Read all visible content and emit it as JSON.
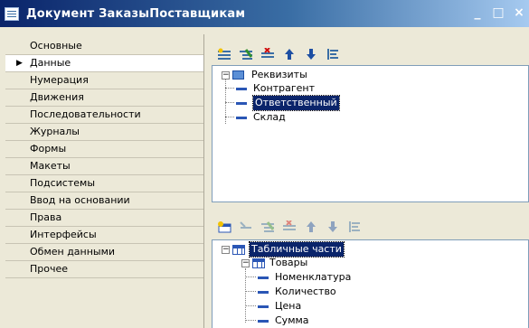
{
  "window": {
    "title": "Документ ЗаказыПоставщикам",
    "controls": [
      "_",
      "□",
      "×"
    ]
  },
  "nav": {
    "items": [
      {
        "label": "Основные"
      },
      {
        "label": "Данные",
        "selected": true
      },
      {
        "label": "Нумерация"
      },
      {
        "label": "Движения"
      },
      {
        "label": "Последовательности"
      },
      {
        "label": "Журналы"
      },
      {
        "label": "Формы"
      },
      {
        "label": "Макеты"
      },
      {
        "label": "Подсистемы"
      },
      {
        "label": "Ввод на основании"
      },
      {
        "label": "Права"
      },
      {
        "label": "Интерфейсы"
      },
      {
        "label": "Обмен данными"
      },
      {
        "label": "Прочее"
      }
    ]
  },
  "attributes_tree": {
    "root": "Реквизиты",
    "children": [
      "Контрагент",
      "Ответственный",
      "Склад"
    ],
    "selected": "Ответственный"
  },
  "tabular_tree": {
    "root": "Табличные части",
    "table": "Товары",
    "columns": [
      "Номенклатура",
      "Количество",
      "Цена",
      "Сумма"
    ]
  },
  "icons": {
    "toolbar_top": [
      "add-icon",
      "add-child-icon",
      "delete-icon",
      "move-up-icon",
      "move-down-icon",
      "sort-icon"
    ],
    "toolbar_bottom": [
      "add-table-icon",
      "add-icon",
      "add-child-icon",
      "delete-icon",
      "move-up-icon",
      "move-down-icon",
      "sort-icon"
    ]
  }
}
